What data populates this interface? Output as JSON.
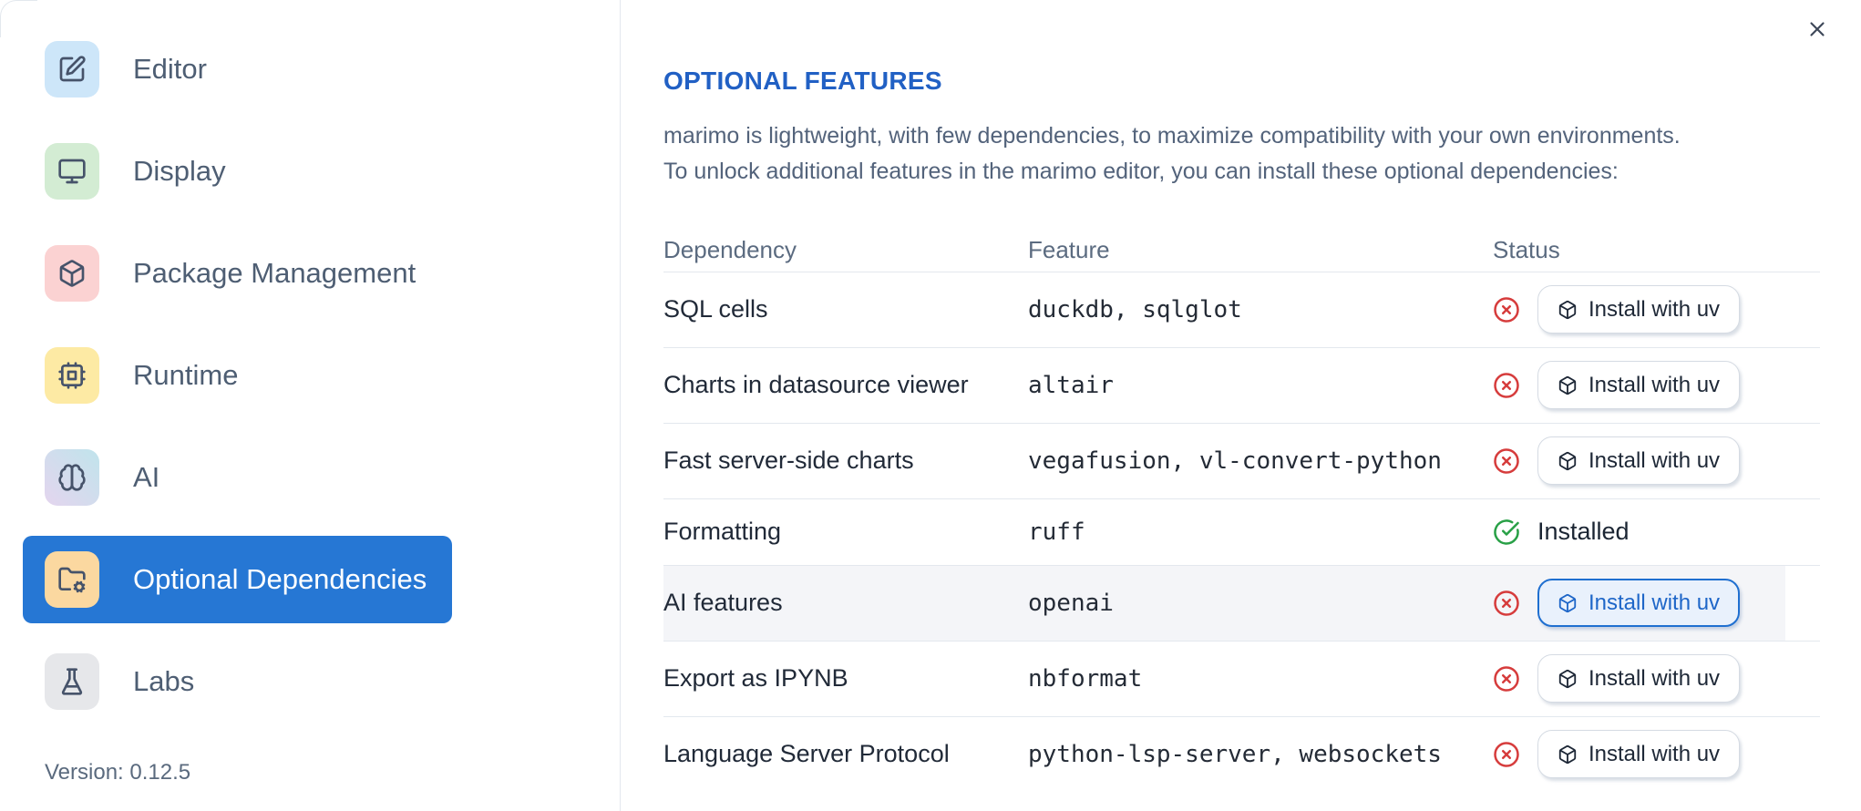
{
  "sidebar": {
    "items": [
      {
        "id": "editor",
        "label": "Editor",
        "icon": "square-pen-icon",
        "icon_bg": "#cde6f9",
        "selected": false
      },
      {
        "id": "display",
        "label": "Display",
        "icon": "monitor-icon",
        "icon_bg": "#d3ecd3",
        "selected": false
      },
      {
        "id": "package-management",
        "label": "Package Management",
        "icon": "package-icon",
        "icon_bg": "#fbd2d2",
        "selected": false
      },
      {
        "id": "runtime",
        "label": "Runtime",
        "icon": "cpu-icon",
        "icon_bg": "#fdeaa4",
        "selected": false
      },
      {
        "id": "ai",
        "label": "AI",
        "icon": "brain-icon",
        "icon_bg": "linear-gradient(45deg,#e4d5ee,#c0e4ec)",
        "selected": false
      },
      {
        "id": "optional-dependencies",
        "label": "Optional Dependencies",
        "icon": "folder-cog-icon",
        "icon_bg": "#fbd8a0",
        "selected": true
      },
      {
        "id": "labs",
        "label": "Labs",
        "icon": "flask-icon",
        "icon_bg": "#e6e7ea",
        "selected": false
      }
    ],
    "version_label": "Version: 0.12.5"
  },
  "panel": {
    "title": "OPTIONAL FEATURES",
    "description_line1": "marimo is lightweight, with few dependencies, to maximize compatibility with your own environments.",
    "description_line2": "To unlock additional features in the marimo editor, you can install these optional dependencies:",
    "table": {
      "columns": [
        "Dependency",
        "Feature",
        "Status"
      ],
      "install_button_label": "Install with uv",
      "installed_label": "Installed",
      "rows": [
        {
          "dependency": "SQL cells",
          "feature": "duckdb, sqlglot",
          "status": "missing",
          "highlighted": false,
          "button_focused": false
        },
        {
          "dependency": "Charts in datasource viewer",
          "feature": "altair",
          "status": "missing",
          "highlighted": false,
          "button_focused": false
        },
        {
          "dependency": "Fast server-side charts",
          "feature": "vegafusion, vl-convert-python",
          "status": "missing",
          "highlighted": false,
          "button_focused": false
        },
        {
          "dependency": "Formatting",
          "feature": "ruff",
          "status": "installed",
          "highlighted": false,
          "button_focused": false
        },
        {
          "dependency": "AI features",
          "feature": "openai",
          "status": "missing",
          "highlighted": true,
          "button_focused": true
        },
        {
          "dependency": "Export as IPYNB",
          "feature": "nbformat",
          "status": "missing",
          "highlighted": false,
          "button_focused": false
        },
        {
          "dependency": "Language Server Protocol",
          "feature": "python-lsp-server, websockets",
          "status": "missing",
          "highlighted": false,
          "button_focused": false
        }
      ]
    }
  },
  "colors": {
    "accent_blue": "#2677d4",
    "heading_blue": "#2160c4",
    "focus_border_blue": "#1f6fd0",
    "focus_text_blue": "#1e66c8",
    "focus_bg_blue": "#e9f1fc",
    "error_red": "#d63c3c",
    "success_green": "#28a046",
    "row_highlight": "#f4f5f8"
  }
}
